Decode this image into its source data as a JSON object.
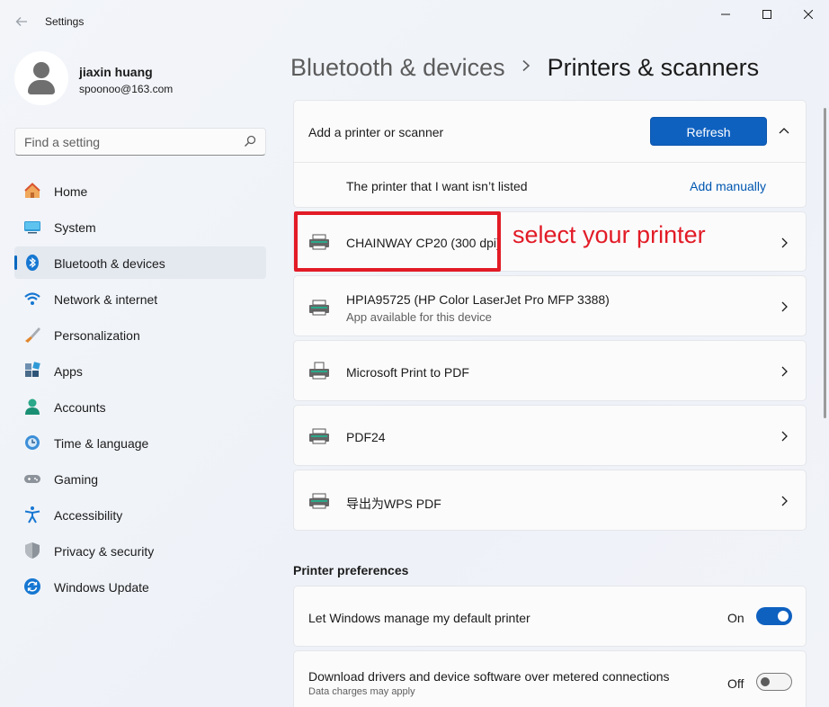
{
  "app": {
    "title": "Settings"
  },
  "profile": {
    "name": "jiaxin huang",
    "email": "spoonoo@163.com"
  },
  "search": {
    "placeholder": "Find a setting"
  },
  "sidebar": {
    "items": [
      {
        "label": "Home",
        "icon": "home-icon"
      },
      {
        "label": "System",
        "icon": "system-icon"
      },
      {
        "label": "Bluetooth & devices",
        "icon": "bluetooth-icon",
        "selected": true
      },
      {
        "label": "Network & internet",
        "icon": "wifi-icon"
      },
      {
        "label": "Personalization",
        "icon": "brush-icon"
      },
      {
        "label": "Apps",
        "icon": "apps-icon"
      },
      {
        "label": "Accounts",
        "icon": "accounts-icon"
      },
      {
        "label": "Time & language",
        "icon": "time-language-icon"
      },
      {
        "label": "Gaming",
        "icon": "gamepad-icon"
      },
      {
        "label": "Accessibility",
        "icon": "accessibility-icon"
      },
      {
        "label": "Privacy & security",
        "icon": "shield-icon"
      },
      {
        "label": "Windows Update",
        "icon": "windows-update-icon"
      }
    ]
  },
  "breadcrumb": {
    "parent": "Bluetooth & devices",
    "separator": ">",
    "current": "Printers & scanners"
  },
  "add_printer": {
    "label": "Add a printer or scanner",
    "refresh_label": "Refresh",
    "not_listed_label": "The printer that I want isn’t listed",
    "add_manually_label": "Add manually"
  },
  "printers": [
    {
      "name": "CHAINWAY CP20 (300 dpi)",
      "sub": ""
    },
    {
      "name": "HPIA95725 (HP Color LaserJet Pro MFP 3388)",
      "sub": "App available for this device"
    },
    {
      "name": "Microsoft Print to PDF",
      "sub": ""
    },
    {
      "name": "PDF24",
      "sub": ""
    },
    {
      "name": "导出为WPS PDF",
      "sub": ""
    }
  ],
  "annotation": {
    "text": "select your printer",
    "color": "#e21b26"
  },
  "preferences": {
    "title": "Printer preferences",
    "default_printer": {
      "label": "Let Windows manage my default printer",
      "state": "On",
      "enabled": true
    },
    "metered": {
      "label": "Download drivers and device software over metered connections",
      "sub": "Data charges may apply",
      "state": "Off",
      "enabled": false
    }
  },
  "colors": {
    "accent": "#0f61c0",
    "link": "#0057b0",
    "annotation": "#e21b26"
  }
}
